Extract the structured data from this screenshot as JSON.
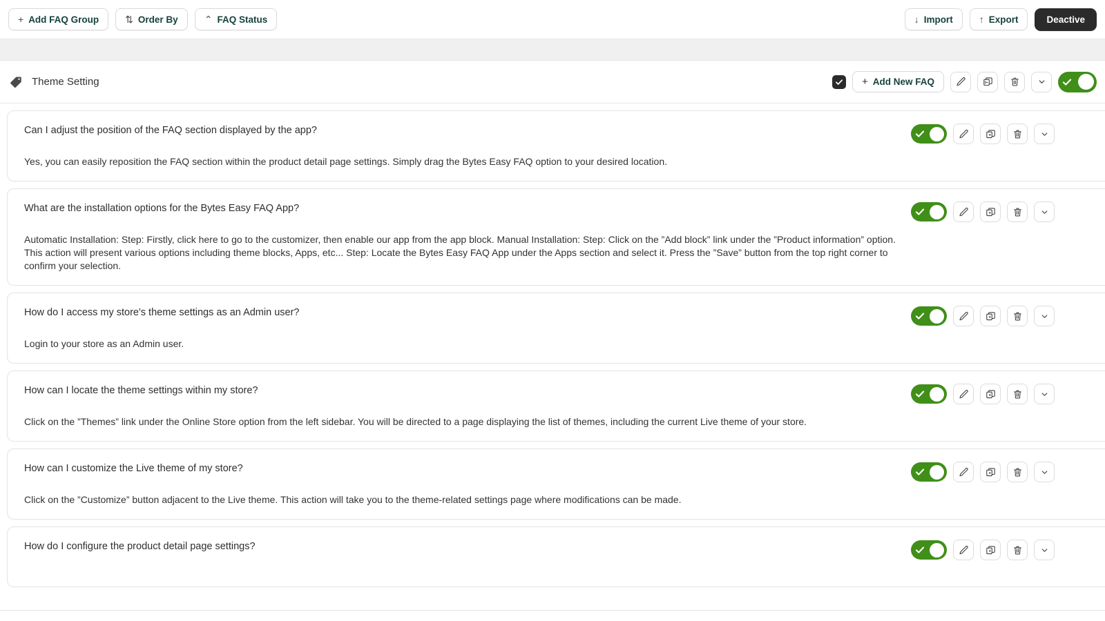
{
  "toolbar": {
    "left_buttons": [
      {
        "label": "Add FAQ Group",
        "icon": "plus-icon",
        "glyph": "+"
      },
      {
        "label": "Order By",
        "icon": "sort-vertical-icon",
        "glyph": "⇅"
      },
      {
        "label": "FAQ Status",
        "icon": "caret-up-icon",
        "glyph": "⌃"
      }
    ],
    "right_buttons": [
      {
        "label": "Import",
        "icon": "arrow-down-icon",
        "glyph": "↓"
      },
      {
        "label": "Export",
        "icon": "arrow-up-icon",
        "glyph": "↑"
      },
      {
        "label": "Deactive",
        "icon": "",
        "glyph": ""
      }
    ]
  },
  "group": {
    "icon": "tag-icon",
    "title": "Theme Setting",
    "checkbox_checked": true,
    "add_new_faq_label": "Add New FAQ",
    "add_new_faq_glyph": "+",
    "actions": [
      "edit-icon",
      "duplicate-icon",
      "delete-icon",
      "expand-icon"
    ],
    "toggle_on": true
  },
  "colors": {
    "toggle_green": "#3f8f18",
    "dark_button": "#2b2b2b",
    "accent_text": "#17423d",
    "panel_border": "#e3e3e3",
    "page_gap": "#f0f0f0"
  },
  "faqs": [
    {
      "question": "Can I adjust the position of the FAQ section displayed by the app?",
      "answer": "Yes, you can easily reposition the FAQ section within the product detail page settings. Simply drag the Bytes Easy FAQ option to your desired location.",
      "toggle_on": true
    },
    {
      "question": "What are the installation options for the Bytes Easy FAQ App?",
      "answer": "Automatic Installation: Step: Firstly, click here to go to the customizer, then enable our app from the app block. Manual Installation: Step: Click on the ”Add block” link under the ”Product information” option. This action will present various options including theme blocks, Apps, etc... Step: Locate the Bytes Easy FAQ App under the Apps section and select it. Press the ”Save” button from the top right corner to confirm your selection.",
      "toggle_on": true
    },
    {
      "question": "How do I access my store's theme settings as an Admin user?",
      "answer": "Login to your store as an Admin user.",
      "toggle_on": true
    },
    {
      "question": "How can I locate the theme settings within my store?",
      "answer": "Click on the ”Themes” link under the Online Store option from the left sidebar. You will be directed to a page displaying the list of themes, including the current Live theme of your store.",
      "toggle_on": true
    },
    {
      "question": "How can I customize the Live theme of my store?",
      "answer": "Click on the ”Customize” button adjacent to the Live theme. This action will take you to the theme-related settings page where modifications can be made.",
      "toggle_on": true
    },
    {
      "question": "How do I configure the product detail page settings?",
      "answer": "",
      "toggle_on": true
    }
  ],
  "faq_actions": [
    "edit-icon",
    "duplicate-icon",
    "delete-icon",
    "expand-icon"
  ]
}
